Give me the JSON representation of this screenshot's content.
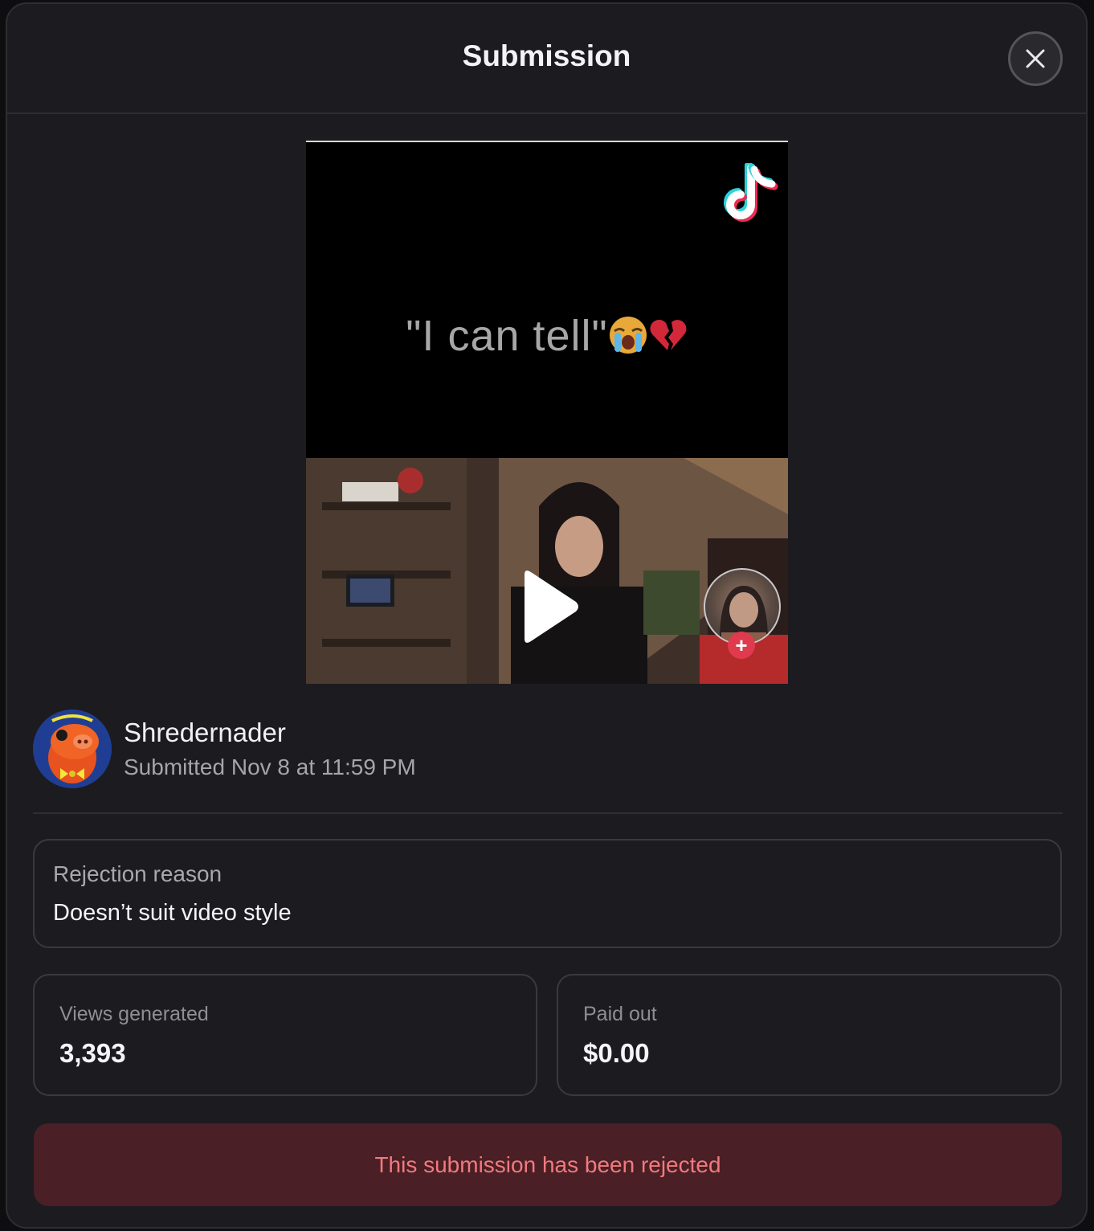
{
  "modal": {
    "title": "Submission",
    "close_icon": "close-icon"
  },
  "video": {
    "caption": "\"I can tell\"",
    "caption_emojis": [
      "loudly-crying-face",
      "broken-heart"
    ],
    "platform_icon": "tiktok-icon",
    "play_icon": "play-icon",
    "follow_icon": "plus-icon"
  },
  "submitter": {
    "name": "Shredernader",
    "submitted_text": "Submitted Nov 8 at 11:59 PM"
  },
  "rejection": {
    "label": "Rejection reason",
    "value": "Doesn’t suit video style"
  },
  "stats": {
    "views_label": "Views generated",
    "views_value": "3,393",
    "paid_label": "Paid out",
    "paid_value": "$0.00"
  },
  "status": {
    "message": "This submission has been rejected",
    "color": "#f07a7e",
    "background": "#4a1f25"
  }
}
